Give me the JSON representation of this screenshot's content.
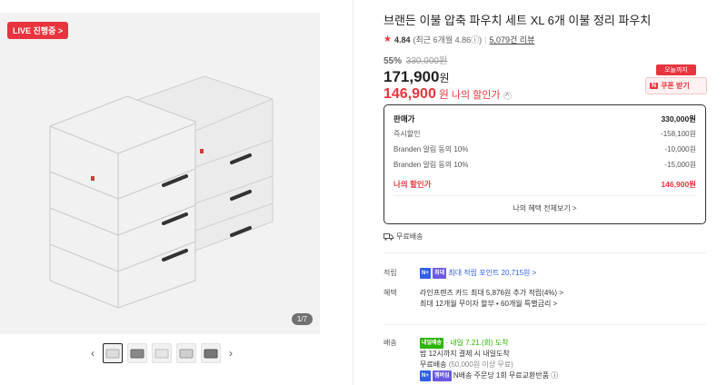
{
  "gallery": {
    "live_badge": "LIVE 진행중 >",
    "counter": "1/7",
    "thumb_count": 5
  },
  "product": {
    "title": "브랜든 이불 압축 파우치 세트 XL 6개 이불 정리 파우치",
    "rating": "4.84",
    "rating_sub": "(최근 6개월 4.86ⓘ)",
    "reviews": "5,079건 리뷰",
    "discount_pct": "55%",
    "original_price": "330,000원",
    "sale_price": "171,900",
    "sale_unit": "원",
    "my_price": "146,900",
    "my_price_unit": "원",
    "my_price_label": "나의 할인가"
  },
  "coupon": {
    "today_label": "오늘까지",
    "n_mark": "N",
    "button_label": "쿠폰 받기"
  },
  "price_box": {
    "rows": [
      {
        "label": "판매가",
        "value": "330,000원"
      },
      {
        "label": "즉시할인",
        "value": "-158,100원"
      },
      {
        "label": "Branden 알림 동의 10%",
        "value": "-10,000원"
      },
      {
        "label": "Branden 알림 동의 10%",
        "value": "-15,000원"
      }
    ],
    "final_label": "나의 할인가",
    "final_value": "146,900원",
    "more_label": "나의 혜택 전체보기 >"
  },
  "shipping_free": "무료배송",
  "points": {
    "label": "적립",
    "n_tag": "N+",
    "max_tag": "최대",
    "text": "최대 적립 포인트 20,715원 >"
  },
  "benefits": {
    "label": "혜택",
    "line1": "라인프렌즈 카드 최대 5,876원 추가 적립(4%) >",
    "line2": "최대 12개월 무이자 할부 • 60개월 특별금리 >"
  },
  "delivery": {
    "label": "배송",
    "arrival_tag": "내일배송",
    "arrival_text": "· 내일 7.21.(화) 도착",
    "line2": "밤 12시까지 결제 시 내일도착",
    "line3": "무료배송",
    "line3_sub": "(50,000원 이상 무료)",
    "n_tag": "N+",
    "member_tag": "멤버십",
    "line4": "N배송 주문당 1회 무료교환반품 ⓘ"
  }
}
